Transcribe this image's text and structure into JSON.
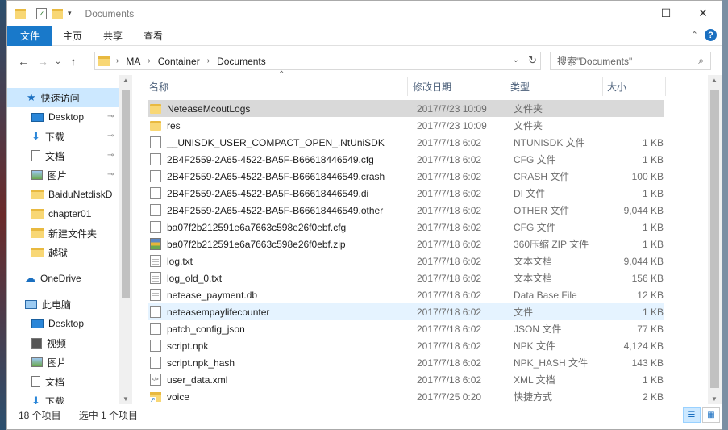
{
  "window": {
    "title": "Documents",
    "controls": {
      "minimize": "—",
      "maximize": "☐",
      "close": "✕"
    }
  },
  "ribbon": {
    "tabs": [
      "文件",
      "主页",
      "共享",
      "查看"
    ],
    "expand_icon": "⌃",
    "help": "?"
  },
  "nav": {
    "back": "←",
    "forward": "→",
    "recent": "⌄",
    "up": "↑",
    "breadcrumbs": [
      "MA",
      "Container",
      "Documents"
    ],
    "refresh": "↻",
    "search_placeholder": "搜索\"Documents\"",
    "search_icon": "⌕"
  },
  "sidebar": {
    "items": [
      {
        "label": "快速访问",
        "icon": "star-icon",
        "selected": true
      },
      {
        "label": "Desktop",
        "icon": "desktop-icon",
        "pinned": true
      },
      {
        "label": "下载",
        "icon": "download-icon",
        "pinned": true
      },
      {
        "label": "文档",
        "icon": "document-icon",
        "pinned": true
      },
      {
        "label": "图片",
        "icon": "picture-icon",
        "pinned": true
      },
      {
        "label": "BaiduNetdiskD",
        "icon": "folder-icon"
      },
      {
        "label": "chapter01",
        "icon": "folder-icon"
      },
      {
        "label": "新建文件夹",
        "icon": "folder-icon"
      },
      {
        "label": "越狱",
        "icon": "folder-icon"
      },
      {
        "label": "OneDrive",
        "icon": "cloud-icon"
      },
      {
        "label": "此电脑",
        "icon": "computer-icon"
      },
      {
        "label": "Desktop",
        "icon": "desktop-icon"
      },
      {
        "label": "视频",
        "icon": "video-icon"
      },
      {
        "label": "图片",
        "icon": "picture-icon"
      },
      {
        "label": "文档",
        "icon": "document-icon"
      },
      {
        "label": "下载",
        "icon": "download-icon"
      }
    ],
    "pin_glyph": "📌"
  },
  "columns": {
    "name": "名称",
    "date": "修改日期",
    "type": "类型",
    "size": "大小",
    "sort_arrow": "⌃"
  },
  "files": [
    {
      "name": "NeteaseMcoutLogs",
      "date": "2017/7/23 10:09",
      "type": "文件夹",
      "size": "",
      "icon": "folder-icon",
      "state": "selected"
    },
    {
      "name": "res",
      "date": "2017/7/23 10:09",
      "type": "文件夹",
      "size": "",
      "icon": "folder-icon"
    },
    {
      "name": "__UNISDK_USER_COMPACT_OPEN_.NtUniSDK",
      "date": "2017/7/18 6:02",
      "type": "NTUNISDK 文件",
      "size": "1 KB",
      "icon": "blank-file-icon"
    },
    {
      "name": "2B4F2559-2A65-4522-BA5F-B66618446549.cfg",
      "date": "2017/7/18 6:02",
      "type": "CFG 文件",
      "size": "1 KB",
      "icon": "blank-file-icon"
    },
    {
      "name": "2B4F2559-2A65-4522-BA5F-B66618446549.crash",
      "date": "2017/7/18 6:02",
      "type": "CRASH 文件",
      "size": "100 KB",
      "icon": "blank-file-icon"
    },
    {
      "name": "2B4F2559-2A65-4522-BA5F-B66618446549.di",
      "date": "2017/7/18 6:02",
      "type": "DI 文件",
      "size": "1 KB",
      "icon": "blank-file-icon"
    },
    {
      "name": "2B4F2559-2A65-4522-BA5F-B66618446549.other",
      "date": "2017/7/18 6:02",
      "type": "OTHER 文件",
      "size": "9,044 KB",
      "icon": "blank-file-icon"
    },
    {
      "name": "ba07f2b212591e6a7663c598e26f0ebf.cfg",
      "date": "2017/7/18 6:02",
      "type": "CFG 文件",
      "size": "1 KB",
      "icon": "blank-file-icon"
    },
    {
      "name": "ba07f2b212591e6a7663c598e26f0ebf.zip",
      "date": "2017/7/18 6:02",
      "type": "360压缩 ZIP 文件",
      "size": "1 KB",
      "icon": "zip-icon"
    },
    {
      "name": "log.txt",
      "date": "2017/7/18 6:02",
      "type": "文本文档",
      "size": "9,044 KB",
      "icon": "text-file-icon"
    },
    {
      "name": "log_old_0.txt",
      "date": "2017/7/18 6:02",
      "type": "文本文档",
      "size": "156 KB",
      "icon": "text-file-icon"
    },
    {
      "name": "netease_payment.db",
      "date": "2017/7/18 6:02",
      "type": "Data Base File",
      "size": "12 KB",
      "icon": "db-file-icon"
    },
    {
      "name": "neteasempaylifecounter",
      "date": "2017/7/18 6:02",
      "type": "文件",
      "size": "1 KB",
      "icon": "blank-file-icon",
      "state": "hover"
    },
    {
      "name": "patch_config_json",
      "date": "2017/7/18 6:02",
      "type": "JSON 文件",
      "size": "77 KB",
      "icon": "blank-file-icon"
    },
    {
      "name": "script.npk",
      "date": "2017/7/18 6:02",
      "type": "NPK 文件",
      "size": "4,124 KB",
      "icon": "blank-file-icon"
    },
    {
      "name": "script.npk_hash",
      "date": "2017/7/18 6:02",
      "type": "NPK_HASH 文件",
      "size": "143 KB",
      "icon": "blank-file-icon"
    },
    {
      "name": "user_data.xml",
      "date": "2017/7/18 6:02",
      "type": "XML 文档",
      "size": "1 KB",
      "icon": "xml-file-icon"
    },
    {
      "name": "voice",
      "date": "2017/7/25 0:20",
      "type": "快捷方式",
      "size": "2 KB",
      "icon": "shortcut-icon"
    }
  ],
  "status": {
    "count": "18 个项目",
    "selection": "选中 1 个项目"
  },
  "colors": {
    "accent": "#1979ca",
    "selected_row": "#d9d9d9",
    "hover_row": "#e5f3ff",
    "nav_selected": "#cce8ff"
  }
}
